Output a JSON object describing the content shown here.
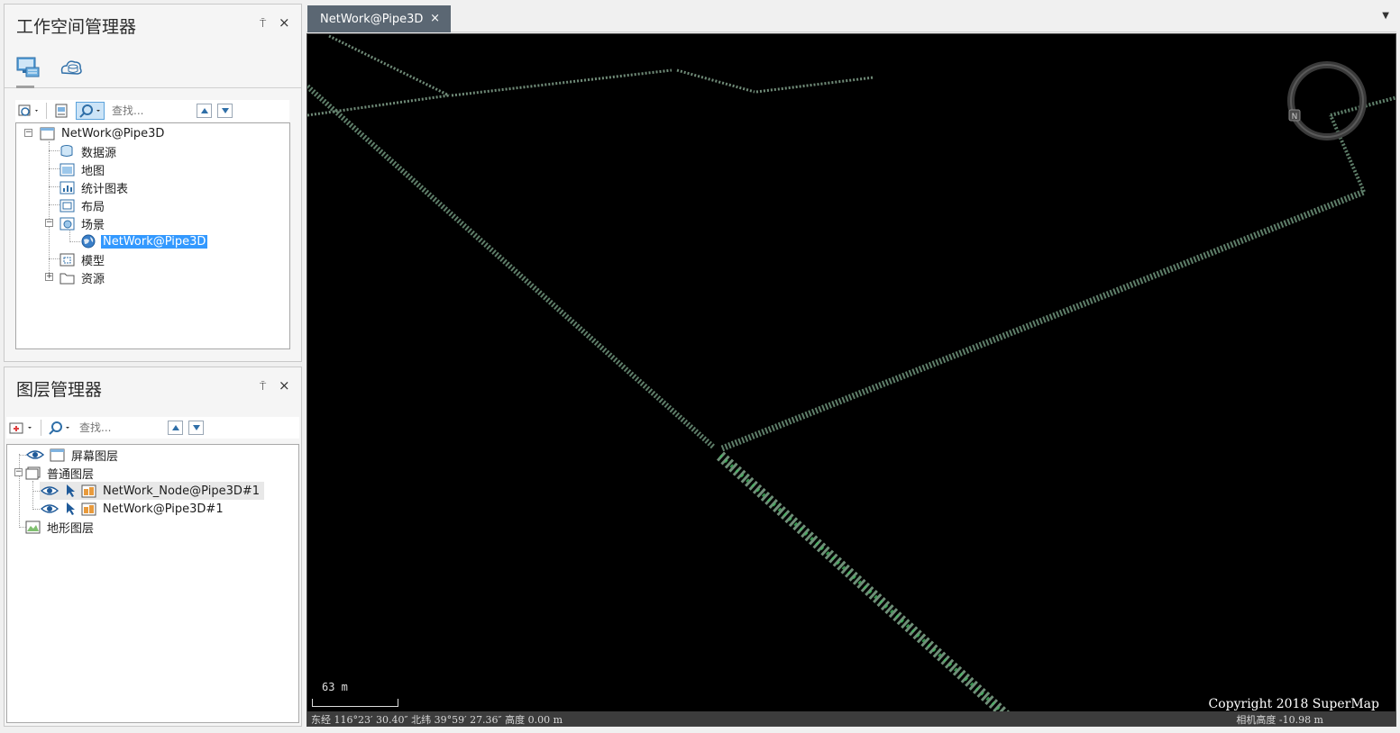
{
  "workspace_panel": {
    "title": "工作空间管理器",
    "pin": "⍑",
    "close": "×",
    "search_placeholder": "查找...",
    "tree": {
      "root": "NetWork@Pipe3D",
      "items": [
        "数据源",
        "地图",
        "统计图表",
        "布局",
        "场景",
        "模型",
        "资源"
      ],
      "scene_child": "NetWork@Pipe3D"
    }
  },
  "layer_panel": {
    "title": "图层管理器",
    "pin": "⍑",
    "close": "×",
    "search_placeholder": "查找...",
    "tree": {
      "screen_layer": "屏幕图层",
      "normal_layer": "普通图层",
      "layer_1": "NetWork_Node@Pipe3D#1",
      "layer_2": "NetWork@Pipe3D#1",
      "terrain_layer": "地形图层"
    }
  },
  "tabs": [
    {
      "label": "NetWork@Pipe3D",
      "close": "×"
    }
  ],
  "tab_menu": "▼",
  "viewport": {
    "scale_label": "63 m",
    "copyright": "Copyright 2018 SuperMap",
    "status_left": "东经 116°23′ 30.40″   北纬 39°59′ 27.36″   高度 0.00 m",
    "status_right": "相机高度 -10.98 m"
  },
  "colors": {
    "selection": "#3399ff",
    "tab_bg": "#5b6773",
    "pipe": "#5f7f6a",
    "pipe_node": "#3fbf5f"
  }
}
